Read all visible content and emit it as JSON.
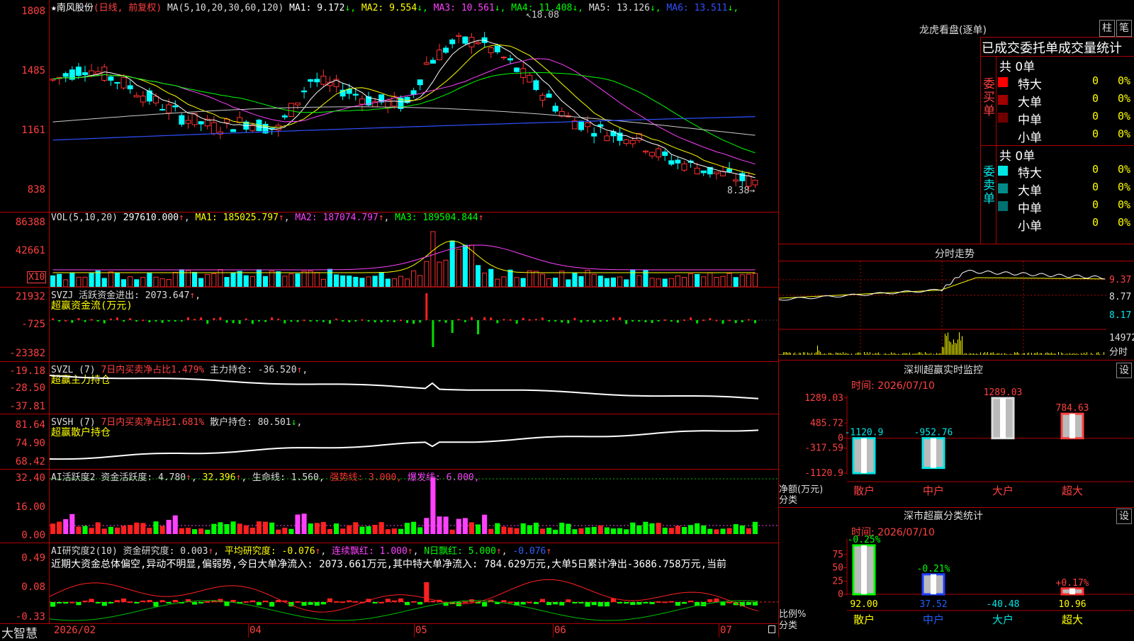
{
  "stock": {
    "name": "★南风股份",
    "mode": "(日线, 前复权)",
    "ma_line": "MA(5,10,20,30,60,120)",
    "ma": [
      {
        "label": "MA1: 9.172",
        "arrow": "↓",
        "color": "#ffffff"
      },
      {
        "label": "MA2: 9.554",
        "arrow": "↓",
        "color": "#ffff00"
      },
      {
        "label": "MA3: 10.561",
        "arrow": "↓",
        "color": "#ff40ff"
      },
      {
        "label": "MA4: 11.408",
        "arrow": "↓",
        "color": "#00ff00"
      },
      {
        "label": "MA5: 13.126",
        "arrow": "↓",
        "color": "#dddddd"
      },
      {
        "label": "MA6: 13.511",
        "arrow": "↓",
        "color": "#3050ff"
      }
    ],
    "high_label": "18.08",
    "low_label": "8.38"
  },
  "price_axis": [
    "1808",
    "1485",
    "1161",
    "838"
  ],
  "vol": {
    "header": "VOL(5,10,20)",
    "value": "297610.000",
    "ma1": "MA1: 185025.797",
    "ma2": "MA2: 187074.797",
    "ma3": "MA3: 189504.844",
    "axis": [
      "86388",
      "42661",
      "X10"
    ]
  },
  "svzj": {
    "header": "SVZJ",
    "title": "活跃资金进出: 2073.647",
    "sub": "超赢资金流(万元)",
    "axis": [
      "21932",
      "-725",
      "-23382"
    ]
  },
  "svzl": {
    "header": "SVZL (7)",
    "ratio": "7日内买卖净占比1.479%",
    "hold": "主力持仓: -36.520",
    "sub": "超赢主力持仓",
    "axis": [
      "-19.18",
      "-28.50",
      "-37.81"
    ]
  },
  "svsh": {
    "header": "SVSH (7)",
    "ratio": "7日内买卖净占比1.681%",
    "hold": "散户持仓: 80.501",
    "sub": "超赢散户持仓",
    "axis": [
      "81.64",
      "74.90",
      "68.42"
    ]
  },
  "ai1": {
    "header": "AI活跃度2",
    "v1": "资金活跃度: 4.780",
    "v2": "32.396",
    "v3": "生命线: 1.560,",
    "v4": "强势线: 3.000,",
    "v5": "爆发线: 6.000,",
    "axis": [
      "32.40",
      "16.00",
      "0.00"
    ]
  },
  "ai2": {
    "header": "AI研究度2(10)",
    "v1": "资金研究度: 0.003",
    "v2": "平均研究度: -0.076",
    "v3": "连续飘红: 1.000",
    "v4": "N日飘红: 5.000",
    "v5": "-0.076",
    "note": "近期大资金总体偏空,异动不明显,偏弱势,今日大单净流入: 2073.661万元,其中特大单净流入: 784.629万元,大单5日累计净出-3686.758万元,当前",
    "axis": [
      "0.49",
      "0.08",
      "-0.33"
    ]
  },
  "bottom": {
    "brand": "大智慧",
    "dates": [
      "2026/02",
      "04",
      "05",
      "06",
      "07"
    ]
  },
  "right": {
    "title": "龙虎看盘(逐单)",
    "btn1": "柱",
    "btn2": "笔",
    "sub": "已成交委托单成交量统计",
    "buy_label": "委买单",
    "sell_label": "委卖单",
    "buy_total": "共 0单",
    "sell_total": "共 0单",
    "buy_rows": [
      {
        "name": "特大",
        "count": "0",
        "pct": "0%",
        "color": "#ff0000"
      },
      {
        "name": "大单",
        "count": "0",
        "pct": "0%",
        "color": "#a00000"
      },
      {
        "name": "中单",
        "count": "0",
        "pct": "0%",
        "color": "#700000"
      },
      {
        "name": "小单",
        "count": "0",
        "pct": "0%",
        "color": "#000000"
      }
    ],
    "sell_rows": [
      {
        "name": "特大",
        "count": "0",
        "pct": "0%",
        "color": "#00e5e5"
      },
      {
        "name": "大单",
        "count": "0",
        "pct": "0%",
        "color": "#008a8a"
      },
      {
        "name": "中单",
        "count": "0",
        "pct": "0%",
        "color": "#007070"
      },
      {
        "name": "小单",
        "count": "0",
        "pct": "0%",
        "color": "#000000"
      }
    ],
    "intraday_title": "分时走势",
    "intraday_axis": [
      "9.37",
      "8.77",
      "8.17",
      "14972"
    ],
    "intraday_vol_unit": "分时",
    "monitor_title": "深圳超赢实时监控",
    "monitor_btn": "设",
    "monitor_time": "时间: 2026/07/10",
    "monitor_axis": [
      "1289.03",
      "485.72",
      "0",
      "-317.59",
      "-1120.9"
    ],
    "monitor_unit": "净额(万元)",
    "monitor_cat": "分类",
    "stats_title": "深市超赢分类统计",
    "stats_btn": "设",
    "stats_time": "时间: 2026/07/10",
    "stats_axis": [
      "75",
      "50",
      "25",
      "0"
    ],
    "stats_unit": "比例%",
    "stats_cat": "分类"
  },
  "chart_data": [
    {
      "type": "bar",
      "title": "深圳超赢实时监控",
      "ylabel": "净额(万元)",
      "categories": [
        "散户",
        "中户",
        "大户",
        "超大"
      ],
      "values": [
        -1120.9,
        -952.76,
        1289.03,
        784.63
      ],
      "value_labels": [
        "-1120.9",
        "-952.76",
        "1289.03",
        "784.63"
      ],
      "ylim": [
        -1120.9,
        1289.03
      ]
    },
    {
      "type": "bar",
      "title": "深市超赢分类统计",
      "ylabel": "比例%",
      "categories": [
        "散户",
        "中户",
        "大户",
        "超大"
      ],
      "values": [
        92.0,
        37.52,
        -40.48,
        10.96
      ],
      "value_labels": [
        "92.00",
        "37.52",
        "-40.48",
        "10.96"
      ],
      "change_labels": [
        "-0.25%",
        "-0.21%",
        "",
        "+0.17%"
      ],
      "ylim": [
        0,
        100
      ]
    }
  ]
}
